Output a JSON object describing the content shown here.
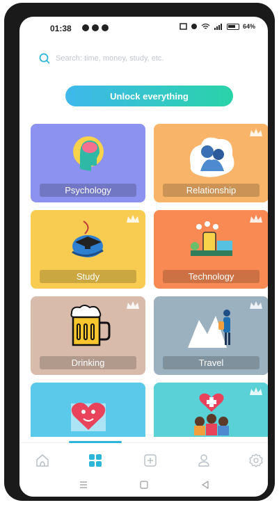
{
  "status_bar": {
    "time": "01:38",
    "battery_percent": "64%"
  },
  "search": {
    "placeholder": "Search: time, money, study, etc."
  },
  "unlock_button": {
    "label": "Unlock everything"
  },
  "categories": [
    {
      "label": "Psychology",
      "color": "#8c92ef",
      "locked": false
    },
    {
      "label": "Relationship",
      "color": "#f8b56a",
      "locked": true
    },
    {
      "label": "Study",
      "color": "#f8cc50",
      "locked": true
    },
    {
      "label": "Technology",
      "color": "#f98a54",
      "locked": true
    },
    {
      "label": "Drinking",
      "color": "#d8bbab",
      "locked": true
    },
    {
      "label": "Travel",
      "color": "#9bb1bf",
      "locked": true
    },
    {
      "label": "",
      "color": "#5bc9ea",
      "locked": false
    },
    {
      "label": "",
      "color": "#5ad0d7",
      "locked": true
    }
  ],
  "bottom_nav": {
    "items": [
      "home-icon",
      "categories-icon",
      "add-icon",
      "profile-icon",
      "settings-icon"
    ],
    "active": "categories-icon",
    "accent": "#2bb5d8"
  }
}
